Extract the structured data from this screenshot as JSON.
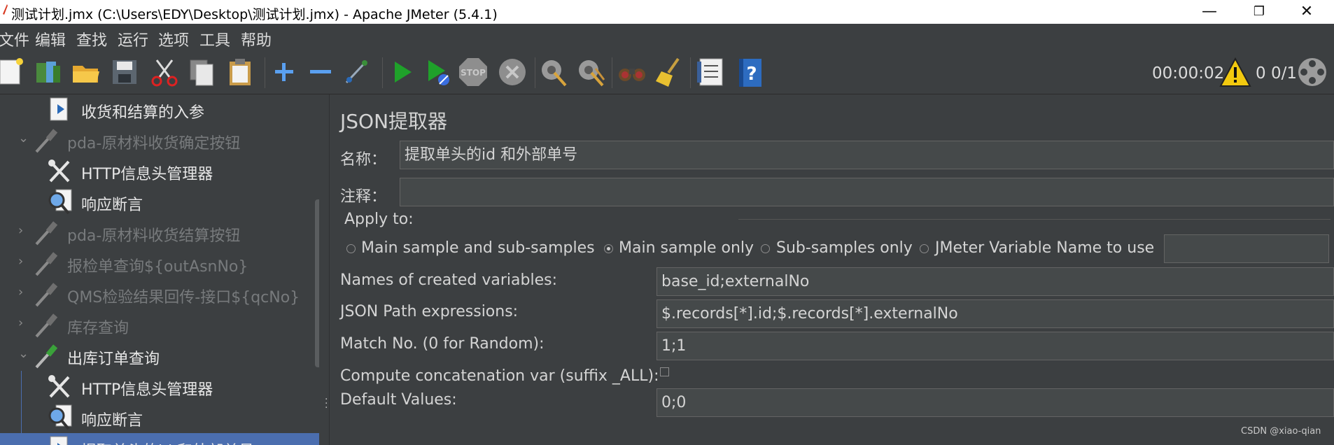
{
  "window": {
    "title": "测试计划.jmx (C:\\Users\\EDY\\Desktop\\测试计划.jmx) - Apache JMeter (5.4.1)",
    "minimize": "—",
    "maximize": "❐",
    "close": "✕"
  },
  "menu": [
    "文件",
    "编辑",
    "查找",
    "运行",
    "选项",
    "工具",
    "帮助"
  ],
  "toolbar": {
    "timer": "00:00:02",
    "counts": "0 0/1",
    "icons": [
      "new-icon",
      "templates-icon",
      "open-icon",
      "save-icon",
      "cut-icon",
      "copy-icon",
      "paste-icon",
      "expand-icon",
      "collapse-icon",
      "toggle-icon",
      "start-icon",
      "start-no-pause-icon",
      "stop-icon",
      "shutdown-icon",
      "clear-icon",
      "clear-all-icon",
      "search-icon",
      "reset-search-icon",
      "function-helper-icon",
      "help-icon"
    ]
  },
  "tree": [
    {
      "label": "收货和结算的入参",
      "state": "lit",
      "icon": "document-arrow-icon",
      "chevron": false
    },
    {
      "label": "pda-原材料收货确定按钮",
      "state": "dim",
      "icon": "pipette-icon",
      "chevron": "⌄"
    },
    {
      "label": "HTTP信息头管理器",
      "state": "lit",
      "icon": "tools-icon",
      "chevron": false
    },
    {
      "label": "响应断言",
      "state": "lit",
      "icon": "magnifier-icon",
      "chevron": false
    },
    {
      "label": "pda-原材料收货结算按钮",
      "state": "dim",
      "icon": "pipette-icon",
      "chevron": "›"
    },
    {
      "label": "报检单查询${outAsnNo}",
      "state": "dim",
      "icon": "pipette-icon",
      "chevron": "›"
    },
    {
      "label": "QMS检验结果回传-接口${qcNo}",
      "state": "dim",
      "icon": "pipette-icon",
      "chevron": "›"
    },
    {
      "label": "库存查询",
      "state": "dim",
      "icon": "pipette-icon",
      "chevron": "›"
    },
    {
      "label": "出库订单查询",
      "state": "lit",
      "icon": "pipette-green-icon",
      "chevron": "⌄"
    },
    {
      "label": "HTTP信息头管理器",
      "state": "lit",
      "icon": "tools-icon",
      "chevron": false
    },
    {
      "label": "响应断言",
      "state": "lit",
      "icon": "magnifier-icon",
      "chevron": false
    },
    {
      "label": "提取单头的id 和外部单号",
      "state": "sel",
      "icon": "document-arrow-icon",
      "chevron": false
    }
  ],
  "panel": {
    "heading": "JSON提取器",
    "name_label": "名称：",
    "name_value": "提取单头的id 和外部单号",
    "comment_label": "注释：",
    "comment_value": "",
    "apply_to_label": "Apply to:",
    "apply_options": [
      {
        "label": "Main sample and sub-samples",
        "selected": false
      },
      {
        "label": "Main sample only",
        "selected": true
      },
      {
        "label": "Sub-samples only",
        "selected": false
      },
      {
        "label": "JMeter Variable Name to use",
        "selected": false
      }
    ],
    "jmeter_var_value": "",
    "names_label": "Names of created variables:",
    "names_value": "base_id;externalNo",
    "json_path_label": "JSON Path expressions:",
    "json_path_value": "$.records[*].id;$.records[*].externalNo",
    "match_label": "Match No. (0 for Random):",
    "match_value": "1;1",
    "concat_label": "Compute concatenation var (suffix _ALL):",
    "concat_checked": false,
    "default_label": "Default Values:",
    "default_value": "0;0"
  },
  "watermark": "CSDN @xiao-qian"
}
